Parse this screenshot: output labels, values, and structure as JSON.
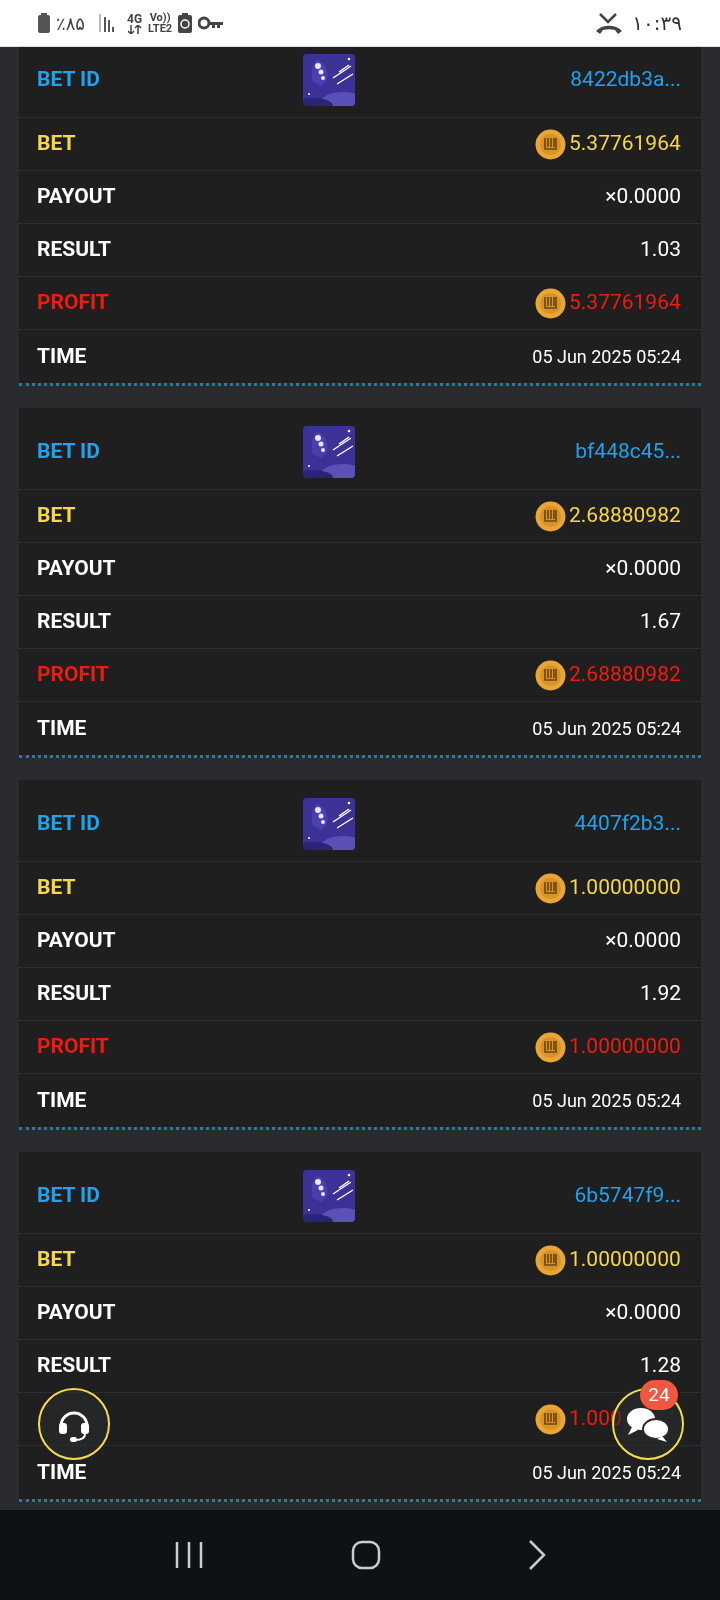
{
  "status_bar": {
    "battery": "٪۸۵",
    "network": "4G",
    "volte_top": "Vo))",
    "volte_bottom": "LTE2",
    "time": "۱۰:۳۹"
  },
  "bets": [
    {
      "rows": [
        {
          "kind": "id",
          "label": "BET ID",
          "value": "8422db3a..."
        },
        {
          "kind": "bet",
          "label": "BET",
          "value": "5.37761964"
        },
        {
          "kind": "payout",
          "label": "PAYOUT",
          "value": "×0.0000"
        },
        {
          "kind": "result",
          "label": "RESULT",
          "value": "1.03"
        },
        {
          "kind": "profit",
          "label": "PROFIT",
          "value": "5.37761964"
        },
        {
          "kind": "time",
          "label": "TIME",
          "value": "05 Jun 2025 05:24"
        }
      ]
    },
    {
      "rows": [
        {
          "kind": "id",
          "label": "BET ID",
          "value": "bf448c45..."
        },
        {
          "kind": "bet",
          "label": "BET",
          "value": "2.68880982"
        },
        {
          "kind": "payout",
          "label": "PAYOUT",
          "value": "×0.0000"
        },
        {
          "kind": "result",
          "label": "RESULT",
          "value": "1.67"
        },
        {
          "kind": "profit",
          "label": "PROFIT",
          "value": "2.68880982"
        },
        {
          "kind": "time",
          "label": "TIME",
          "value": "05 Jun 2025 05:24"
        }
      ]
    },
    {
      "rows": [
        {
          "kind": "id",
          "label": "BET ID",
          "value": "4407f2b3..."
        },
        {
          "kind": "bet",
          "label": "BET",
          "value": "1.00000000"
        },
        {
          "kind": "payout",
          "label": "PAYOUT",
          "value": "×0.0000"
        },
        {
          "kind": "result",
          "label": "RESULT",
          "value": "1.92"
        },
        {
          "kind": "profit",
          "label": "PROFIT",
          "value": "1.00000000"
        },
        {
          "kind": "time",
          "label": "TIME",
          "value": "05 Jun 2025 05:24"
        }
      ]
    },
    {
      "rows": [
        {
          "kind": "id",
          "label": "BET ID",
          "value": "6b5747f9..."
        },
        {
          "kind": "bet",
          "label": "BET",
          "value": "1.00000000"
        },
        {
          "kind": "payout",
          "label": "PAYOUT",
          "value": "×0.0000"
        },
        {
          "kind": "result",
          "label": "RESULT",
          "value": "1.28"
        },
        {
          "kind": "profit",
          "value": "1.000"
        },
        {
          "kind": "time",
          "label": "TIME",
          "value": "05 Jun 2025 05:24"
        }
      ]
    }
  ],
  "chat_badge": "24"
}
